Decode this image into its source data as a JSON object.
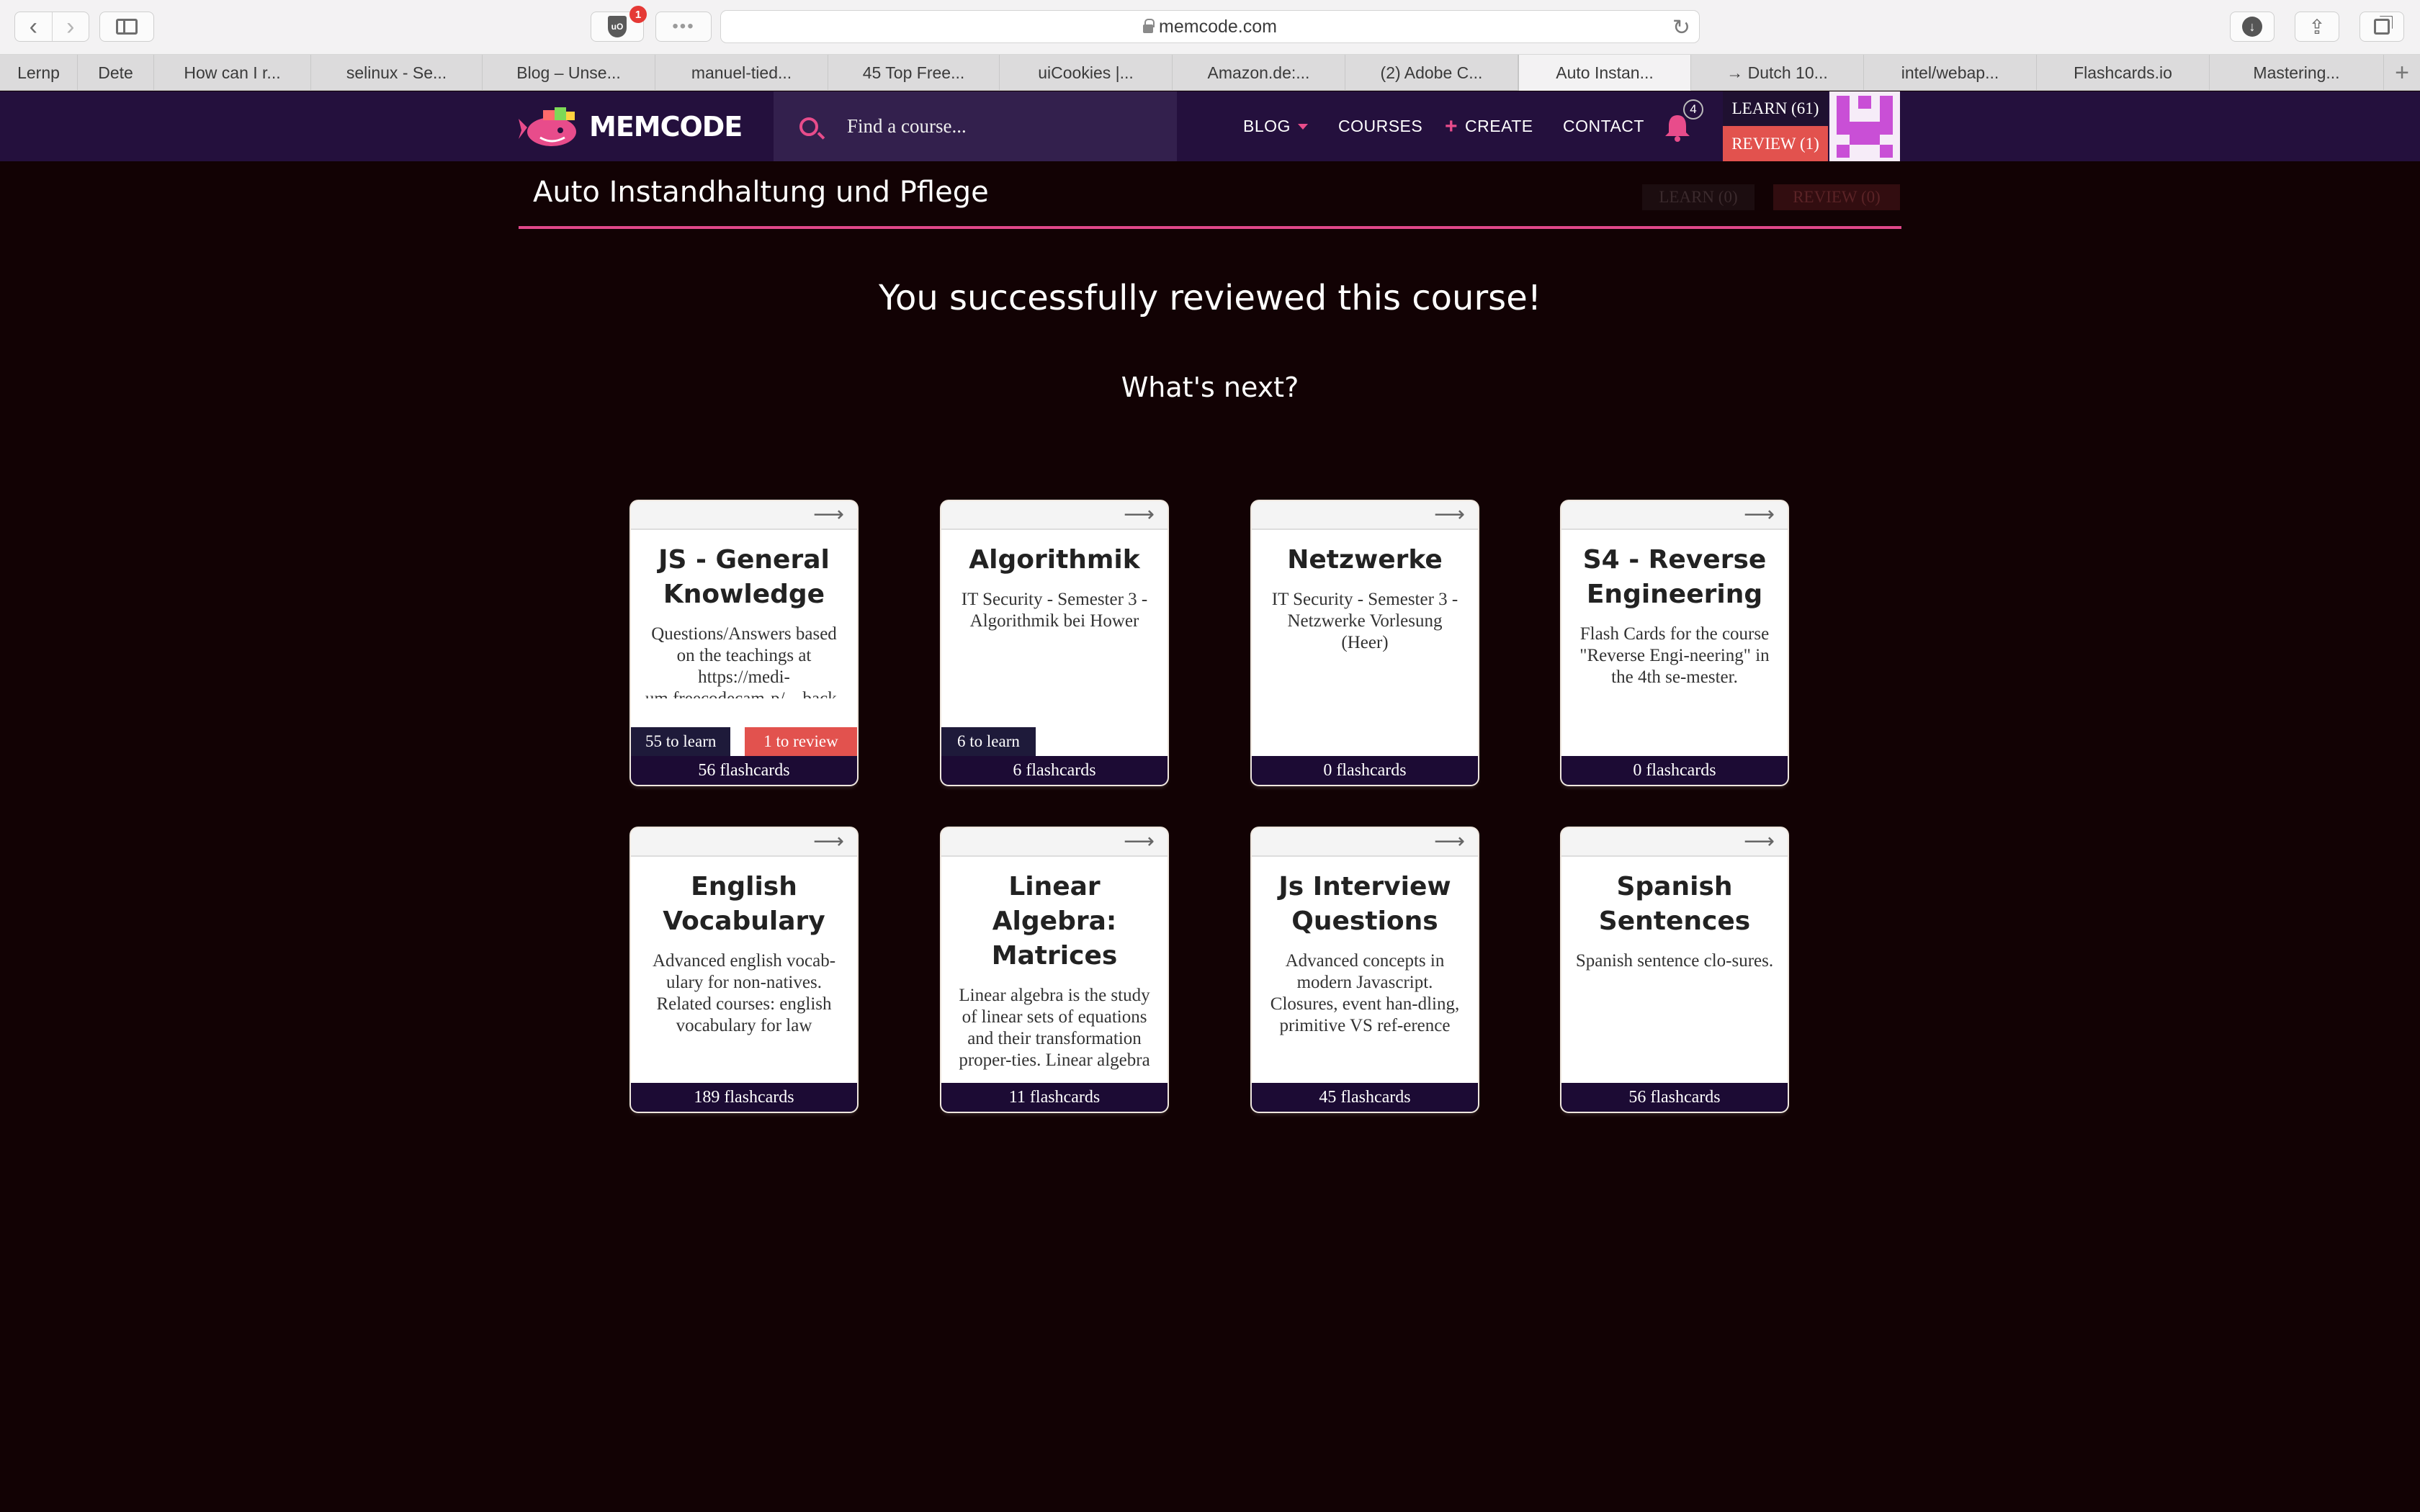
{
  "browser": {
    "url": "memcode.com",
    "ext_badge": "1",
    "tabs": [
      {
        "label": "Lernp"
      },
      {
        "label": "Dete"
      },
      {
        "label": "How can I r..."
      },
      {
        "label": "selinux - Se..."
      },
      {
        "label": "Blog – Unse..."
      },
      {
        "label": "manuel-tied..."
      },
      {
        "label": "45 Top Free..."
      },
      {
        "label": "uiCookies |..."
      },
      {
        "label": "Amazon.de:..."
      },
      {
        "label": "(2) Adobe C..."
      },
      {
        "label": "Auto Instan..."
      },
      {
        "label": "→ Dutch 10..."
      },
      {
        "label": "intel/webap..."
      },
      {
        "label": "Flashcards.io"
      },
      {
        "label": "Mastering..."
      }
    ]
  },
  "header": {
    "logo_text": "MEMCODE",
    "search_placeholder": "Find a course...",
    "nav": {
      "blog": "BLOG",
      "courses": "COURSES",
      "create": "CREATE",
      "contact": "CONTACT"
    },
    "notifications_count": "4",
    "learn": "LEARN (61)",
    "review": "REVIEW (1)"
  },
  "course": {
    "title": "Auto Instandhaltung und Pflege",
    "learn": "LEARN (0)",
    "review": "REVIEW (0)"
  },
  "messages": {
    "success": "You successfully reviewed this course!",
    "next": "What's next?"
  },
  "cards": [
    {
      "title": "JS - General Knowledge",
      "description": "Questions/Answers based on the teachings at https://medi-um.freecodecam-p/…back-fisi…nt",
      "to_learn": "55 to learn",
      "to_review": "1 to review",
      "flashcards": "56 flashcards"
    },
    {
      "title": "Algorithmik",
      "description": "IT Security - Semester 3 - Algorithmik bei Hower",
      "to_learn": "6 to learn",
      "flashcards": "6 flashcards"
    },
    {
      "title": "Netzwerke",
      "description": "IT Security - Semester 3 - Netzwerke Vorlesung (Heer)",
      "flashcards": "0 flashcards"
    },
    {
      "title": "S4 - Reverse Engineering",
      "description": "Flash Cards for the course \"Reverse Engi-neering\" in the 4th se-mester.",
      "flashcards": "0 flashcards"
    },
    {
      "title": "English Vocabulary",
      "description": "Advanced english vocab-ulary for non-natives. Related courses: english vocabulary for law (memcode.com/cour-",
      "flashcards": "189 flashcards"
    },
    {
      "title": "Linear Algebra: Matrices",
      "description": "Linear algebra is the study of linear sets of equations and their transformation proper-ties. Linear algebra al-",
      "flashcards": "11 flashcards"
    },
    {
      "title": "Js Interview Questions",
      "description": "Advanced concepts in modern Javascript. Closures, event han-dling, primitive VS ref-erence data types,",
      "flashcards": "45 flashcards"
    },
    {
      "title": "Spanish Sentences",
      "description": "Spanish sentence clo-sures.",
      "flashcards": "56 flashcards"
    }
  ]
}
